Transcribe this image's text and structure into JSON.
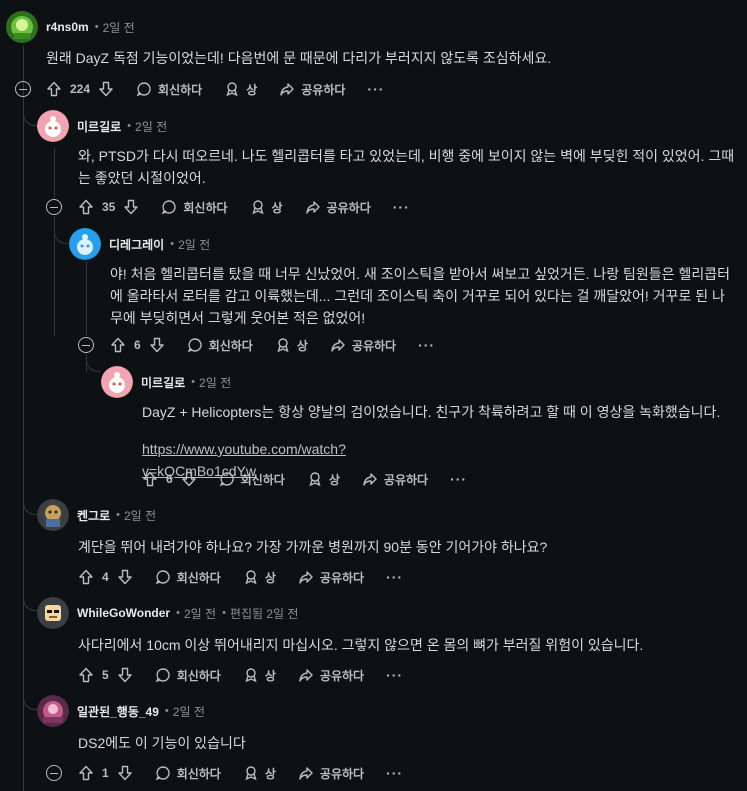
{
  "labels": {
    "reply": "회신하다",
    "award": "상",
    "share": "공유하다",
    "more": "···"
  },
  "comments": [
    {
      "author": "r4ns0m",
      "time": "2일 전",
      "text": "원래 DayZ 독점 기능이었는데! 다음번에 문 때문에 다리가 부러지지 않도록 조심하세요.",
      "votes": "224"
    },
    {
      "author": "미르길로",
      "time": "2일 전",
      "text": "와, PTSD가 다시 떠오르네. 나도 헬리콥터를 타고 있었는데, 비행 중에 보이지 않는 벽에 부딪힌 적이 있었어. 그때는 좋았던 시절이었어.",
      "votes": "35"
    },
    {
      "author": "디레그레이",
      "time": "2일 전",
      "text": "야! 처음 헬리콥터를 탔을 때 너무 신났었어. 새 조이스틱을 받아서 써보고 싶었거든. 나랑 팀원들은 헬리콥터에 올라타서 로터를 감고 이륙했는데... 그런데 조이스틱 축이 거꾸로 되어 있다는 걸 깨달았어! 거꾸로 된 나무에 부딪히면서 그렇게 웃어본 적은 없었어!",
      "votes": "6"
    },
    {
      "author": "미르길로",
      "time": "2일 전",
      "text": "DayZ + Helicopters는 항상 양날의 검이었습니다. 친구가 착륙하려고 할 때 이 영상을 녹화했습니다.",
      "link": "https://www.youtube.com/watch?v=kQCmBo1cdYw",
      "votes": "6"
    },
    {
      "author": "켄그로",
      "time": "2일 전",
      "text": "계단을 뛰어 내려가야 하나요? 가장 가까운 병원까지 90분 동안 기어가야 하나요?",
      "votes": "4"
    },
    {
      "author": "WhileGoWonder",
      "time": "2일 전",
      "edited": "편집됨 2일 전",
      "text": "사다리에서 10cm 이상 뛰어내리지 마십시오. 그렇지 않으면 온 몸의 뼈가 부러질 위험이 있습니다.",
      "votes": "5"
    },
    {
      "author": "일관된_행동_49",
      "time": "2일 전",
      "text": "DS2에도 이 기능이 있습니다",
      "votes": "1"
    }
  ]
}
